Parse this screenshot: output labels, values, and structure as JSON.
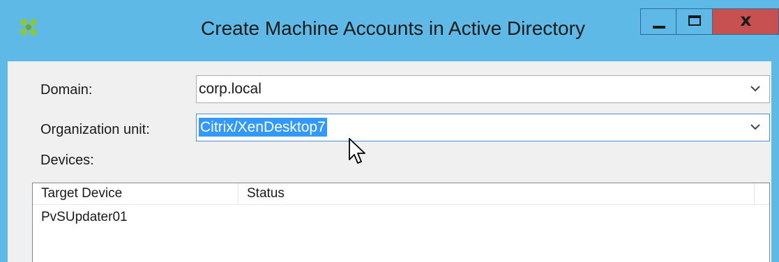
{
  "window": {
    "title": "Create Machine Accounts in Active Directory",
    "close_glyph": "x",
    "colors": {
      "titlebar": "#5fb9e6",
      "close_button": "#c75050",
      "client_bg": "#f0f0f0",
      "selection": "#3399ff"
    }
  },
  "form": {
    "domain_label": "Domain:",
    "domain_value": "corp.local",
    "ou_label": "Organization unit:",
    "ou_value": "Citrix/XenDesktop7",
    "devices_label": "Devices:"
  },
  "devices_table": {
    "columns": [
      "Target Device",
      "Status"
    ],
    "rows": [
      {
        "target_device": "PvSUpdater01",
        "status": ""
      }
    ]
  },
  "icons": {
    "app": "citrix-logo-icon",
    "dropdown": "chevron-down-icon",
    "cursor": "mouse-pointer-icon"
  }
}
